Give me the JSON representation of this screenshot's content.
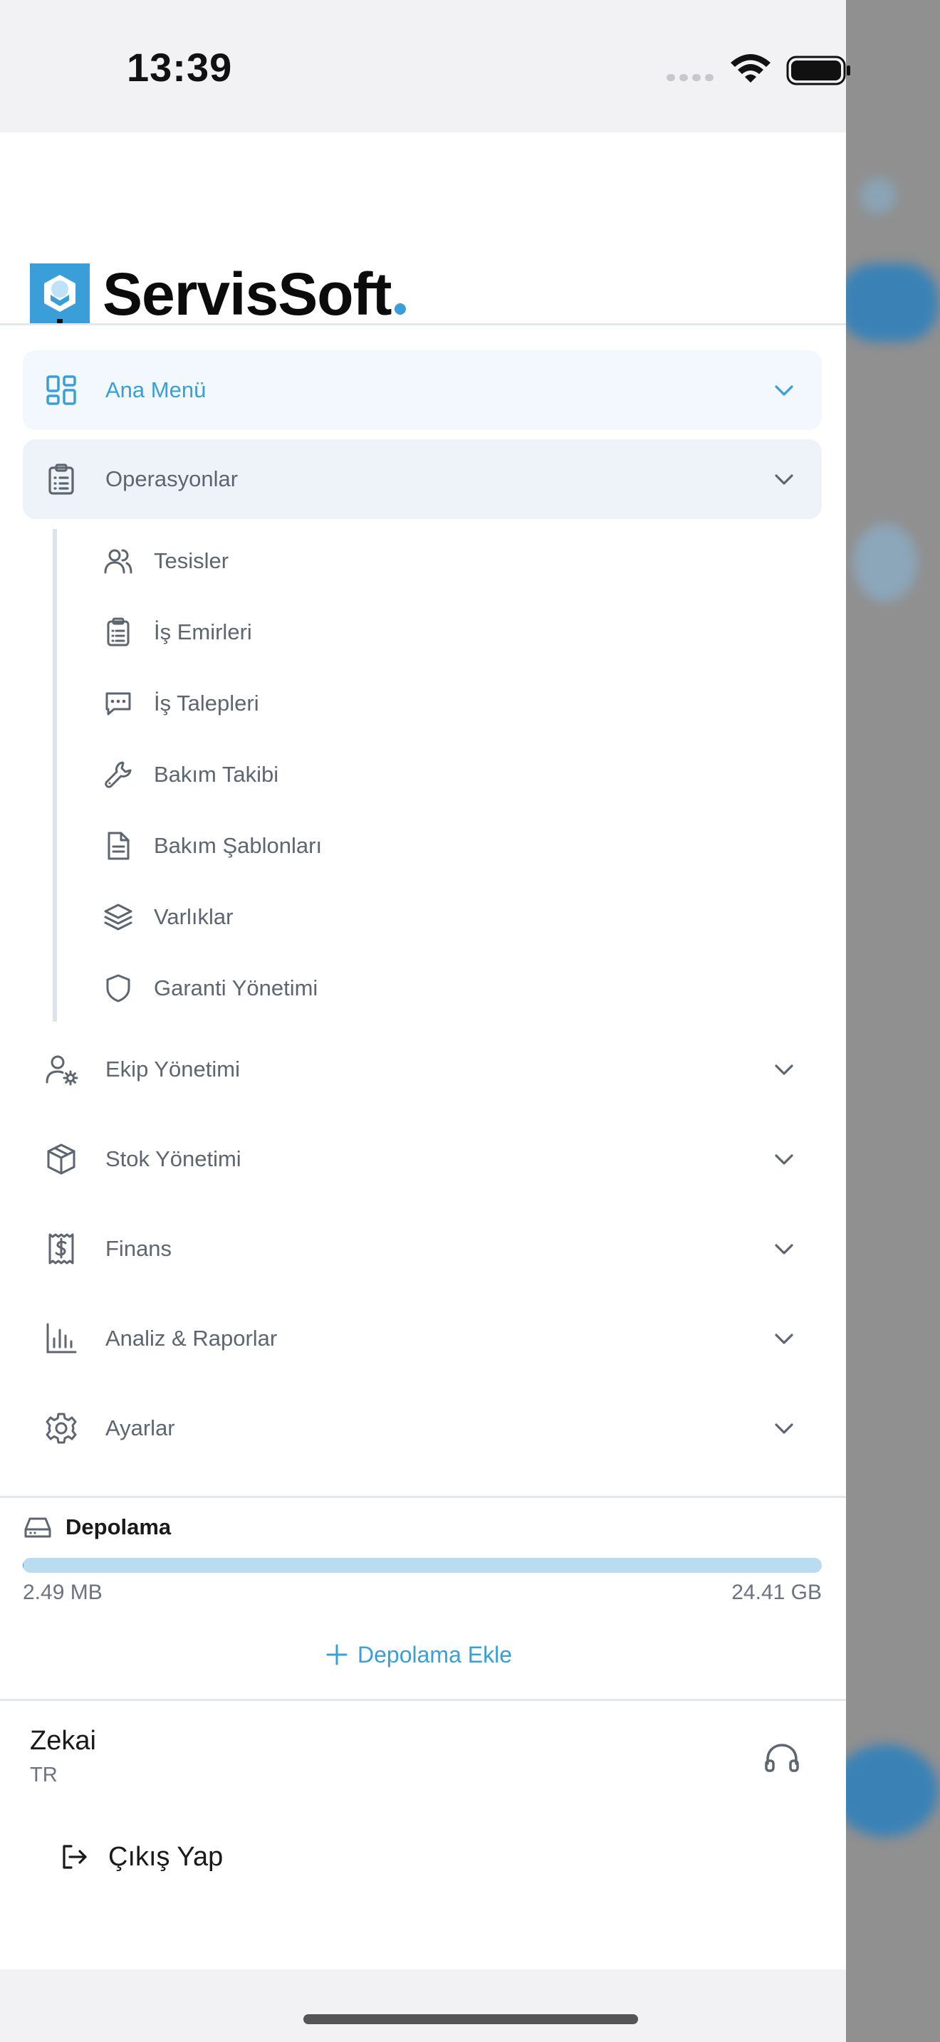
{
  "status": {
    "time": "13:39"
  },
  "brand": {
    "name": "ServisSoft",
    "accent": "#3a9fd9"
  },
  "menu": {
    "main": {
      "label": "Ana Menü",
      "icon": "dashboard-icon"
    },
    "operations": {
      "label": "Operasyonlar",
      "icon": "clipboard-list-icon"
    },
    "sub_items": [
      {
        "label": "Tesisler",
        "icon": "users-icon"
      },
      {
        "label": "İş Emirleri",
        "icon": "clipboard-list-icon"
      },
      {
        "label": "İş Talepleri",
        "icon": "message-icon"
      },
      {
        "label": "Bakım Takibi",
        "icon": "wrench-icon"
      },
      {
        "label": "Bakım Şablonları",
        "icon": "document-icon"
      },
      {
        "label": "Varlıklar",
        "icon": "layers-icon"
      },
      {
        "label": "Garanti Yönetimi",
        "icon": "shield-icon"
      }
    ],
    "sections": [
      {
        "label": "Ekip Yönetimi",
        "icon": "user-cog-icon"
      },
      {
        "label": "Stok Yönetimi",
        "icon": "package-icon"
      },
      {
        "label": "Finans",
        "icon": "receipt-icon"
      },
      {
        "label": "Analiz & Raporlar",
        "icon": "bar-chart-icon"
      },
      {
        "label": "Ayarlar",
        "icon": "gear-icon"
      }
    ]
  },
  "storage": {
    "title": "Depolama",
    "used": "2.49 MB",
    "total": "24.41 GB",
    "used_fraction": 0.0001,
    "add_label": "Depolama Ekle"
  },
  "user": {
    "name": "Zekai",
    "sub": "TR"
  },
  "logout": {
    "label": "Çıkış Yap"
  }
}
